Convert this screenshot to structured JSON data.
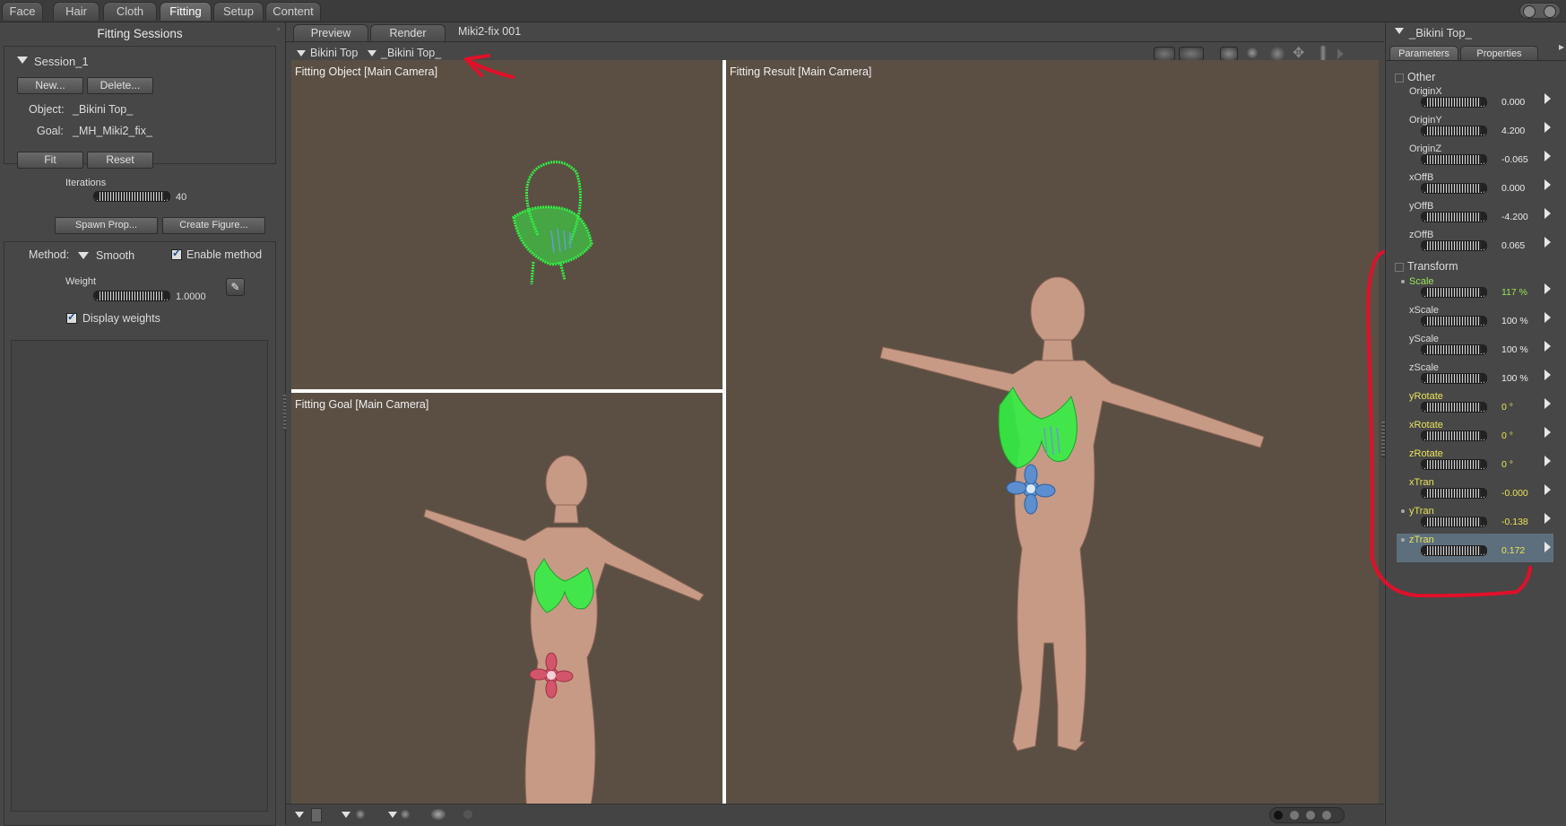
{
  "room_tabs": [
    "Face",
    "Hair",
    "Cloth",
    "Fitting",
    "Setup",
    "Content"
  ],
  "active_room": "Fitting",
  "left_panel": {
    "title": "Fitting Sessions",
    "session_name": "Session_1",
    "new_button": "New...",
    "delete_button": "Delete...",
    "object_label": "Object:",
    "object_value": "_Bikini Top_",
    "goal_label": "Goal:",
    "goal_value": "_MH_Miki2_fix_",
    "fit_button": "Fit",
    "reset_button": "Reset",
    "iterations_label": "Iterations",
    "iterations_value": "40",
    "spawn_prop_button": "Spawn Prop...",
    "create_figure_button": "Create Figure...",
    "method_label": "Method:",
    "method_value": "Smooth",
    "enable_method_label": "Enable method",
    "weight_label": "Weight",
    "weight_value": "1.0000",
    "display_weights_label": "Display weights"
  },
  "viewport": {
    "tabs": [
      "Preview",
      "Render"
    ],
    "document_title": "Miki2-fix 001",
    "figure_select": "Bikini Top",
    "actor_select": "_Bikini Top_",
    "panes": {
      "object": "Fitting Object [Main Camera]",
      "goal": "Fitting Goal [Main Camera]",
      "result": "Fitting Result [Main Camera]"
    }
  },
  "right_panel": {
    "actor_name": "_Bikini Top_",
    "tabs": [
      "Parameters",
      "Properties"
    ],
    "groups": {
      "other": {
        "title": "Other",
        "params": [
          {
            "name": "OriginX",
            "value": "0.000"
          },
          {
            "name": "OriginY",
            "value": "4.200"
          },
          {
            "name": "OriginZ",
            "value": "-0.065"
          },
          {
            "name": "xOffB",
            "value": "0.000"
          },
          {
            "name": "yOffB",
            "value": "-4.200"
          },
          {
            "name": "zOffB",
            "value": "0.065"
          }
        ]
      },
      "transform": {
        "title": "Transform",
        "params": [
          {
            "name": "Scale",
            "value": "117 %"
          },
          {
            "name": "xScale",
            "value": "100 %"
          },
          {
            "name": "yScale",
            "value": "100 %"
          },
          {
            "name": "zScale",
            "value": "100 %"
          },
          {
            "name": "yRotate",
            "value": "0 °"
          },
          {
            "name": "xRotate",
            "value": "0 °"
          },
          {
            "name": "zRotate",
            "value": "0 °"
          },
          {
            "name": "xTran",
            "value": "-0.000"
          },
          {
            "name": "yTran",
            "value": "-0.138"
          },
          {
            "name": "zTran",
            "value": "0.172"
          }
        ]
      }
    }
  },
  "colors": {
    "viewport_bg": "#5b4f43",
    "mesh_green": "#33ee44",
    "annotation_red": "#e0102a",
    "param_yellow": "#e9e35a",
    "param_green": "#9be35a"
  }
}
